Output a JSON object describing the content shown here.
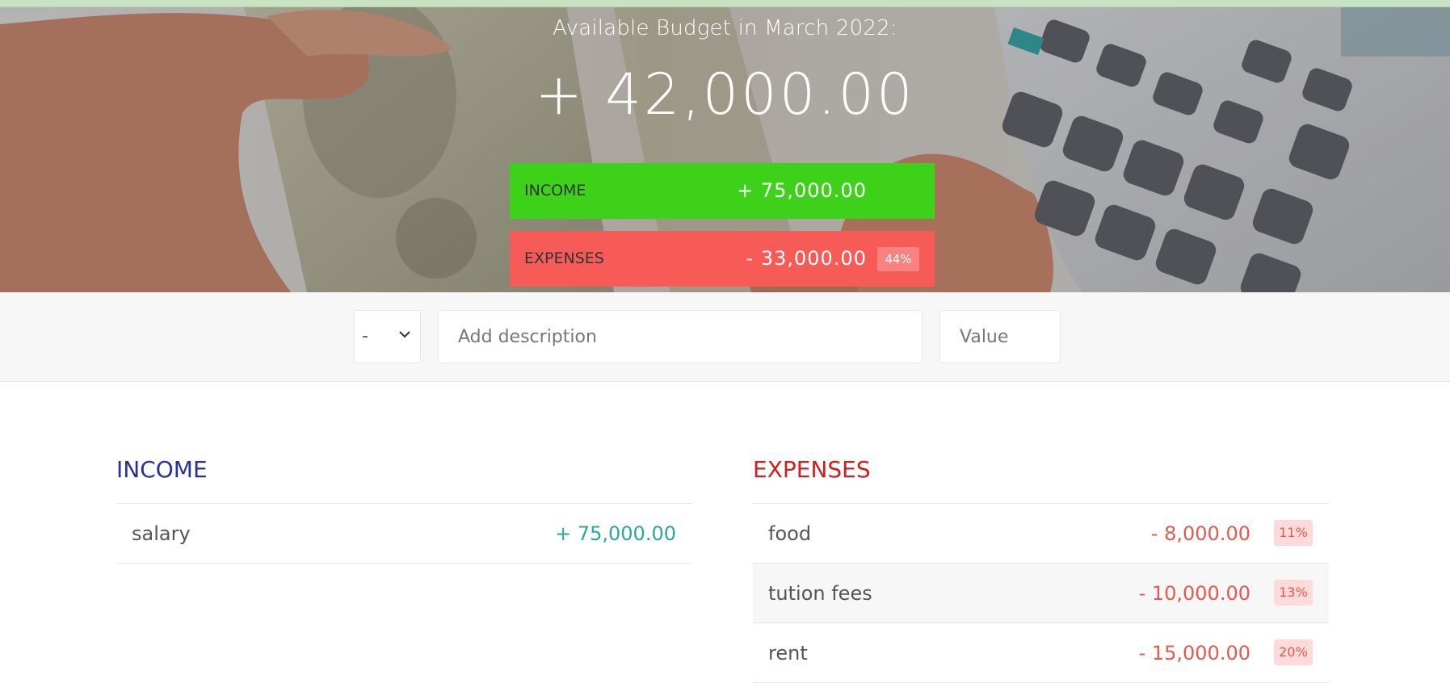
{
  "colors": {
    "income_accent": "#3dd11a",
    "expenses_accent": "#f65b58",
    "income_title": "#28309c",
    "expenses_title": "#d51d1d",
    "income_value": "#2ba79a",
    "expense_value": "#e8584d"
  },
  "header": {
    "title": "Available Budget in March 2022:",
    "value": "+ 42,000.00"
  },
  "summary": {
    "income": {
      "label": "INCOME",
      "value": "+ 75,000.00"
    },
    "expenses": {
      "label": "EXPENSES",
      "value": "- 33,000.00",
      "percentage": "44%"
    }
  },
  "form": {
    "type_value": "-",
    "type_icon": "chevron-down-icon",
    "description_placeholder": "Add description",
    "value_placeholder": "Value"
  },
  "income": {
    "title": "INCOME",
    "items": [
      {
        "description": "salary",
        "value": "+ 75,000.00"
      }
    ]
  },
  "expenses": {
    "title": "EXPENSES",
    "items": [
      {
        "description": "food",
        "value": "- 8,000.00",
        "percentage": "11%"
      },
      {
        "description": "tution fees",
        "value": "- 10,000.00",
        "percentage": "13%"
      },
      {
        "description": "rent",
        "value": "- 15,000.00",
        "percentage": "20%"
      }
    ]
  }
}
